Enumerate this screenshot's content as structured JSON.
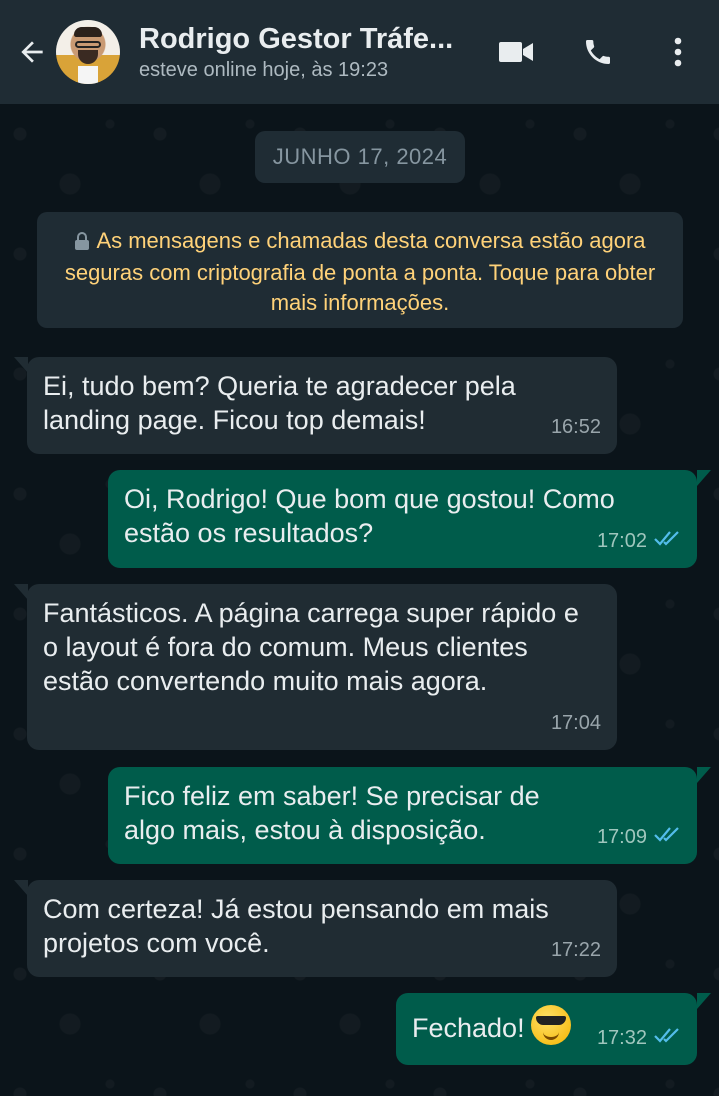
{
  "header": {
    "contact_name": "Rodrigo Gestor Tráfe...",
    "status": "esteve online hoje, às 19:23",
    "icons": [
      "back-arrow-icon",
      "video-call-icon",
      "phone-icon",
      "more-options-icon"
    ]
  },
  "chat": {
    "date_chip": "JUNHO 17, 2024",
    "encryption_notice": "As mensagens e chamadas desta conversa estão agora seguras com criptografia de ponta a ponta. Toque para obter mais informações.",
    "messages": [
      {
        "direction": "in",
        "text": "Ei, tudo bem? Queria te agradecer pela landing page. Ficou top demais!",
        "time": "16:52"
      },
      {
        "direction": "out",
        "text": "Oi, Rodrigo! Que bom que gostou! Como estão os resultados?",
        "time": "17:02",
        "read": true
      },
      {
        "direction": "in",
        "text": "Fantásticos. A página carrega super rápido e o layout é fora do comum. Meus clientes estão convertendo muito mais agora.",
        "time": "17:04"
      },
      {
        "direction": "out",
        "text": "Fico feliz em saber! Se precisar de algo mais, estou à disposição.",
        "time": "17:09",
        "read": true
      },
      {
        "direction": "in",
        "text": "Com certeza! Já estou pensando em mais projetos com você.",
        "time": "17:22"
      },
      {
        "direction": "out",
        "text": "Fechado!",
        "emoji": "smiling-face-with-sunglasses",
        "time": "17:32",
        "read": true
      }
    ]
  },
  "colors": {
    "header_bg": "#1f2c34",
    "chat_bg": "#0b141a",
    "incoming_bubble": "#202c33",
    "outgoing_bubble": "#005c4b",
    "encryption_text": "#ffd279",
    "read_ticks": "#53bdeb"
  }
}
